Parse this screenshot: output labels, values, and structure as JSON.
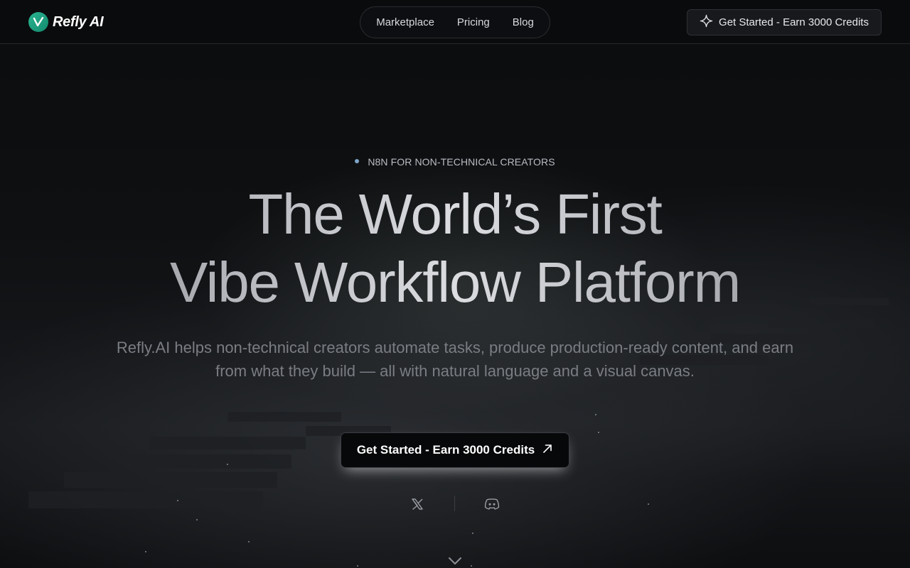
{
  "header": {
    "brand": "Refly AI",
    "nav": [
      "Marketplace",
      "Pricing",
      "Blog"
    ],
    "cta_label": "Get Started - Earn 3000 Credits"
  },
  "hero": {
    "eyebrow": "N8N FOR NON-TECHNICAL CREATORS",
    "title_line1": "The World’s First",
    "title_line2": "Vibe Workflow Platform",
    "subtitle": "Refly.AI helps non-technical creators automate tasks, produce production-ready content, and earn from what they build — all with natural language and a visual canvas.",
    "cta_label": "Get Started - Earn 3000 Credits"
  },
  "socials": [
    "x-icon",
    "discord-icon"
  ],
  "colors": {
    "background": "#090a0c",
    "brand_green": "#1fa37f",
    "eyebrow_dot": "#7fa6c9"
  }
}
